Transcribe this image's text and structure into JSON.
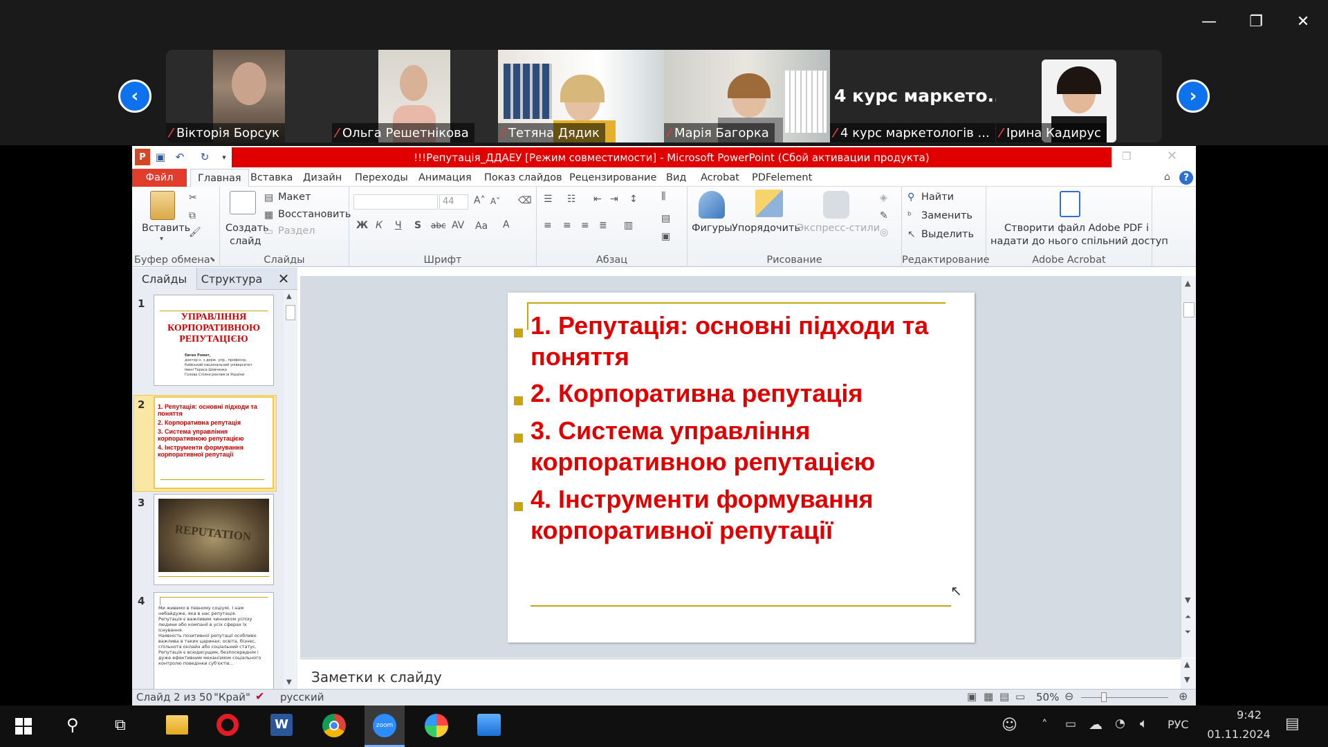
{
  "zoom": {
    "participants": [
      {
        "name": "Вікторія Борсук",
        "muted": true
      },
      {
        "name": "Ольга Решетнікова",
        "muted": true
      },
      {
        "name": "Тетяна Дядик",
        "muted": true
      },
      {
        "name": "Марія Багорка",
        "muted": true
      },
      {
        "name": "4 курс маркетологів ...",
        "muted": true,
        "tile_text": "4 курс маркето..."
      },
      {
        "name": "Ірина Кадирус",
        "muted": true
      }
    ],
    "window_controls": {
      "minimize": "—",
      "restore": "❐",
      "close": "✕"
    },
    "nav_prev": "‹",
    "nav_next": "›"
  },
  "powerpoint": {
    "title": "!!!Репутація_ДДАЕУ [Режим совместимости] - Microsoft PowerPoint (Сбой активации продукта)",
    "tabs": [
      "Файл",
      "Главная",
      "Вставка",
      "Дизайн",
      "Переходы",
      "Анимация",
      "Показ слайдов",
      "Рецензирование",
      "Вид",
      "Acrobat",
      "PDFelement"
    ],
    "ribbon": {
      "clipboard": {
        "paste": "Вставить",
        "group": "Буфер обмена"
      },
      "slides": {
        "create": "Создать",
        "create2": "слайд",
        "layout": "Макет",
        "reset": "Восстановить",
        "section": "Раздел",
        "group": "Слайды"
      },
      "font": {
        "size": "44",
        "group": "Шрифт",
        "bold": "Ж",
        "italic": "К",
        "underline": "Ч",
        "shadow": "S",
        "strike": "abc",
        "spacing": "AV",
        "case": "Aa",
        "color": "A"
      },
      "paragraph": {
        "group": "Абзац"
      },
      "drawing": {
        "shapes": "Фигуры",
        "arrange": "Упорядочить",
        "styles": "Экспресс-стили",
        "group": "Рисование"
      },
      "editing": {
        "find": "Найти",
        "replace": "Заменить",
        "select": "Выделить",
        "group": "Редактирование"
      },
      "acrobat": {
        "line1": "Створити файл Adobe PDF і",
        "line2": "надати до нього спільний доступ",
        "group": "Adobe Acrobat"
      }
    },
    "pane_tabs": {
      "slides": "Слайды",
      "outline": "Структура"
    },
    "thumbnails": [
      {
        "num": "1",
        "title": "УПРАВЛІННЯ КОРПОРАТИВНОЮ РЕПУТАЦІЄЮ",
        "lines": [
          "Євген Ромат,",
          "доктор н. з держ. упр., професор,",
          "Київський національний університет",
          "імені Тараса Шевченка",
          "Голова Спілки реклам.ів України"
        ]
      },
      {
        "num": "2",
        "lines": [
          "1. Репутація: основні підходи та поняття",
          "2. Корпоративна репутація",
          "3. Система управління корпоративною репутацією",
          "4. Інструменти формування корпоративної репутації"
        ]
      },
      {
        "num": "3",
        "image_text": "REPUTATION"
      },
      {
        "num": "4",
        "lines": [
          "Ми живемо в певному соціумі. І нам небайдуже, яка в нас репутація.",
          "Репутація є важливим чинником успіху людини або компанії в усіх сферах їх існування.",
          "Наявність позитивної репутації особливо важлива в таких царинах: освіта, бізнес, спільнота онлайн або соціальний статус.",
          "Репутація є всюдисущим, безпосереднім і дуже ефективним механізмом соціального контролю поведінки суб'єктів..."
        ]
      }
    ],
    "slide": {
      "items": [
        {
          "line1": "1. Репутація: основні підходи та",
          "line2": "поняття"
        },
        {
          "line1": "2. Корпоративна репутація",
          "line2": ""
        },
        {
          "line1": "3. Система управління",
          "line2": "корпоративною репутацією"
        },
        {
          "line1": "4. Інструменти формування",
          "line2": "корпоративної репутації"
        }
      ]
    },
    "notes_placeholder": "Заметки к слайду",
    "status": {
      "slide": "Слайд 2 из 50",
      "theme": "\"Край\"",
      "language": "русский",
      "zoom": "50%"
    }
  },
  "taskbar": {
    "language": "РУС",
    "time": "9:42",
    "date": "01.11.2024",
    "apps": [
      "windows-start",
      "search",
      "task-view",
      "file-explorer",
      "opera",
      "word",
      "chrome",
      "zoom",
      "paint",
      "photos"
    ]
  },
  "colors": {
    "accent_red": "#e00000",
    "bullet": "#c8a410",
    "zoom_blue": "#0e72ed"
  }
}
